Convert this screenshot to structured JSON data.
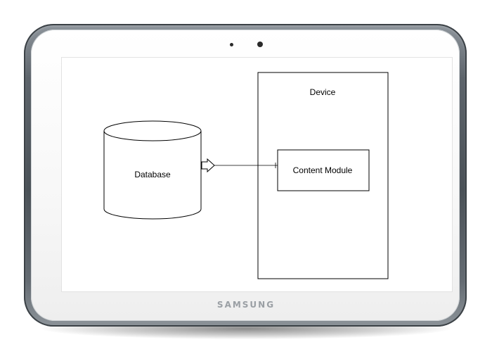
{
  "diagram": {
    "database_label": "Database",
    "device_label": "Device",
    "content_module_label": "Content Module"
  },
  "device_brand": "SAMSUNG",
  "colors": {
    "frame": "#5d646b",
    "bezel": "#f7f7f7",
    "stroke": "#000000"
  }
}
